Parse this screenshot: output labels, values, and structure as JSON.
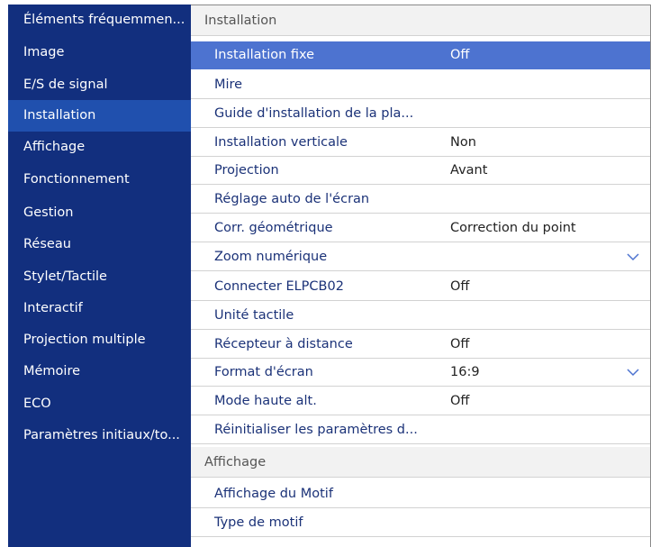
{
  "sidebar": {
    "items": [
      {
        "label": "Éléments fréquemmen..."
      },
      {
        "label": "Image"
      },
      {
        "label": "E/S de signal"
      },
      {
        "label": "Installation",
        "selected": true
      },
      {
        "label": "Affichage"
      },
      {
        "label": "Fonctionnement"
      },
      {
        "label": "Gestion"
      },
      {
        "label": "Réseau"
      },
      {
        "label": "Stylet/Tactile"
      },
      {
        "label": "Interactif"
      },
      {
        "label": "Projection multiple"
      },
      {
        "label": "Mémoire"
      },
      {
        "label": "ECO"
      },
      {
        "label": "Paramètres initiaux/to..."
      }
    ]
  },
  "installation": {
    "section_title": "Installation",
    "rows": [
      {
        "label": "Installation fixe",
        "value": "Off",
        "selected": true
      },
      {
        "label": "Mire",
        "value": ""
      },
      {
        "label": "Guide d'installation de la pla...",
        "value": ""
      },
      {
        "label": "Installation verticale",
        "value": "Non"
      },
      {
        "label": "Projection",
        "value": "Avant"
      },
      {
        "label": "Réglage auto de l'écran",
        "value": ""
      },
      {
        "label": "Corr. géométrique",
        "value": "Correction du point"
      },
      {
        "label": "Zoom numérique",
        "value": "",
        "dropdown": "chevron-down-icon"
      },
      {
        "label": "Connecter ELPCB02",
        "value": "Off"
      },
      {
        "label": "Unité tactile",
        "value": ""
      },
      {
        "label": "Récepteur à distance",
        "value": "Off"
      },
      {
        "label": "Format d'écran",
        "value": "16:9",
        "dropdown": "chevron-down-icon"
      },
      {
        "label": "Mode haute alt.",
        "value": "Off"
      },
      {
        "label": "Réinitialiser les paramètres d...",
        "value": ""
      }
    ]
  },
  "affichage": {
    "section_title": "Affichage",
    "rows": [
      {
        "label": "Affichage du Motif",
        "value": ""
      },
      {
        "label": "Type de motif",
        "value": ""
      }
    ]
  },
  "colors": {
    "sidebar_bg": "#122f7e",
    "sidebar_selected": "#2050ae",
    "row_selected": "#4d73d0",
    "row_text": "#1b3278"
  }
}
